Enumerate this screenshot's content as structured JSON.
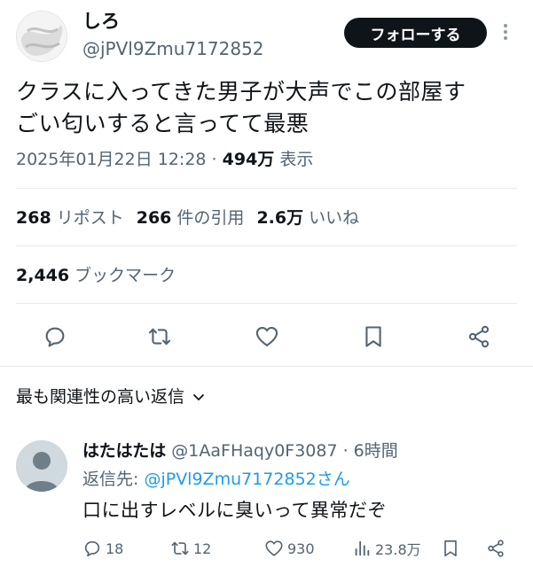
{
  "tweet": {
    "display_name": "しろ",
    "handle": "@jPVl9Zmu7172852",
    "follow_label": "フォローする",
    "text_line1": "クラスに入ってきた男子が大声でこの部屋す",
    "text_line2": "ごい匂いすると言ってて最悪",
    "date": "2025年01月22日 12:28",
    "separator": " · ",
    "views": "494万",
    "views_label": " 表示"
  },
  "stats": {
    "reposts": "268",
    "reposts_label": " リポスト",
    "quotes": "266",
    "quotes_label": " 件の引用",
    "likes": "2.6万",
    "likes_label": " いいね",
    "bookmarks": "2,446",
    "bookmarks_label": " ブックマーク"
  },
  "replies_sort": {
    "label": "最も関連性の高い返信"
  },
  "reply": {
    "name": "はたはたは",
    "handle": "@1AaFHaqy0F3087",
    "time": " · 6時間",
    "replying_prefix": "返信先: ",
    "replying_to": "@jPVl9Zmu7172852さん",
    "text": "口に出すレベルに臭いって異常だぞ",
    "reply_count": "18",
    "repost_count": "12",
    "like_count": "930",
    "view_count": "23.8万"
  },
  "colors": {
    "text": "#0f1419",
    "secondary": "#536471",
    "accent": "#1d9bf0",
    "divider": "#e7e9ea"
  },
  "icons": [
    "more-icon",
    "reply-icon",
    "repost-icon",
    "like-icon",
    "bookmark-icon",
    "share-icon",
    "chevron-down-icon",
    "views-icon"
  ]
}
